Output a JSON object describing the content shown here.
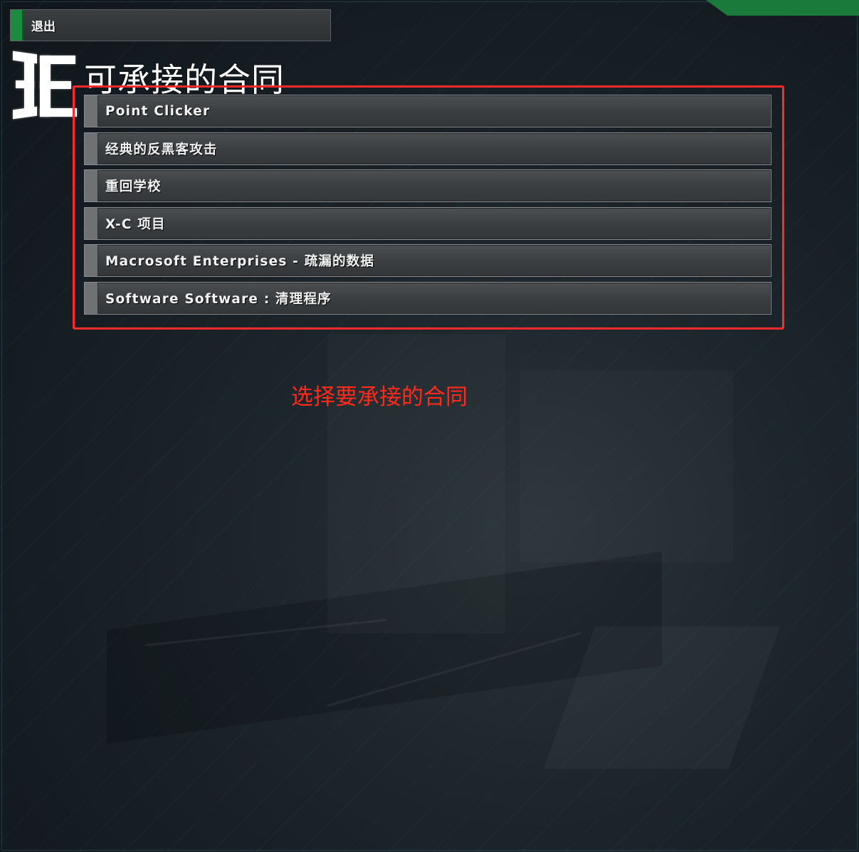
{
  "header": {
    "exit_label": "退出",
    "title": "可承接的合同",
    "logo_icon": "hacknet-3e-logo-icon"
  },
  "contracts": [
    {
      "label": "Point Clicker"
    },
    {
      "label": "经典的反黑客攻击"
    },
    {
      "label": "重回学校"
    },
    {
      "label": "X-C 项目"
    },
    {
      "label": "Macrosoft Enterprises - 疏漏的数据"
    },
    {
      "label": "Software Software : 清理程序"
    }
  ],
  "annotation": {
    "text": "选择要承接的合同",
    "color": "#ff2a1a"
  },
  "colors": {
    "accent_green": "#1c8a3f",
    "highlight_red": "#ff2a2a",
    "background": "#141c22"
  }
}
